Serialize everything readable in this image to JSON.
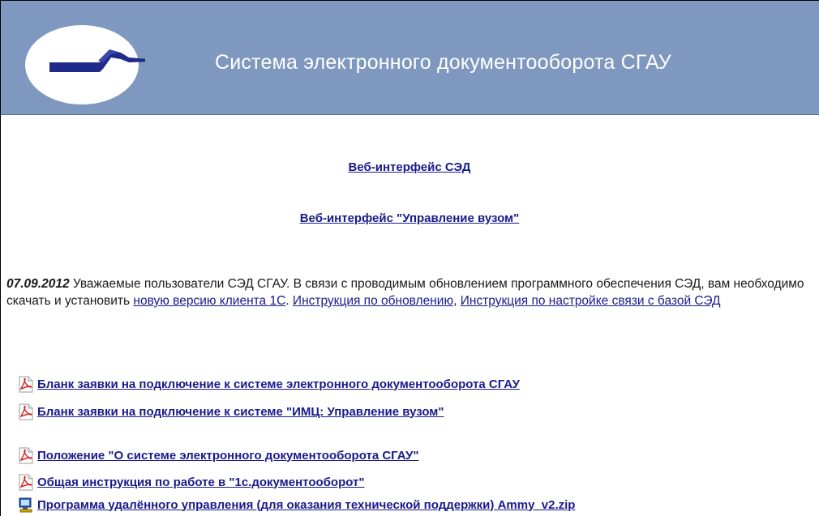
{
  "header": {
    "title": "Система электронного документооборота СГАУ",
    "background": "#7f98bf"
  },
  "links": {
    "web_sed": "Веб-интерфейс СЭД",
    "web_uv": "Веб-интерфейс \"Управление вузом\""
  },
  "notice": {
    "date": "07.09.2012",
    "text_1": " Уважаемые пользователи СЭД СГАУ. В связи с проводимым обновлением программного обеспечения СЭД, вам необходимо скачать и установить ",
    "link_client": "новую версию клиента 1С",
    "sep_1": ". ",
    "link_instr_update": "Инструкция по обновлению",
    "sep_2": ", ",
    "link_instr_connect": "Инструкция по настройке связи с базой СЭД"
  },
  "documents": [
    {
      "icon": "pdf-icon",
      "label": "Бланк заявки на подключение к системе электронного документооборота СГАУ"
    },
    {
      "icon": "pdf-icon",
      "label": "Бланк заявки на подключение к системе \"ИМЦ: Управление вузом\""
    },
    {
      "icon": "pdf-icon",
      "label": "Положение \"О системе электронного документооборота СГАУ\""
    },
    {
      "icon": "pdf-icon",
      "label": "Общая инструкция по работе в \"1с.документооборот\""
    },
    {
      "icon": "program-icon",
      "label": "Программа удалённого управления (для оказания технической поддержки) Ammy_v2.zip"
    }
  ],
  "colors": {
    "link": "#1a1a8c",
    "pdf_red": "#d42020"
  }
}
